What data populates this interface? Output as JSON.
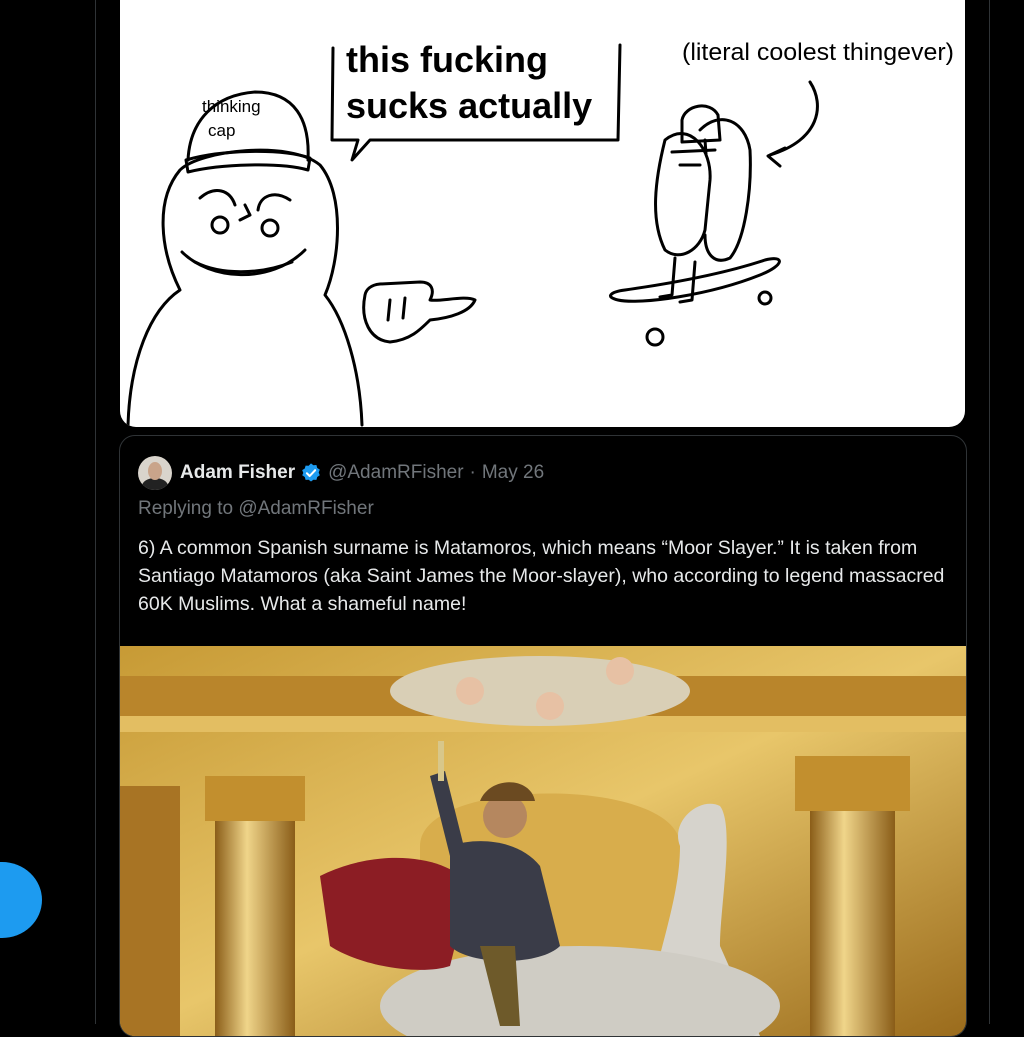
{
  "comic": {
    "cap_label_line1": "thinking",
    "cap_label_line2": "cap",
    "speech_line1": "this fucking",
    "speech_line2": "sucks actually",
    "annotation": "(literal coolest thingever)"
  },
  "quote_tweet": {
    "author_name": "Adam Fisher",
    "author_handle": "@AdamRFisher",
    "separator": "·",
    "date": "May 26",
    "replying_to": "Replying to @AdamRFisher",
    "text": "6) A common Spanish surname is Matamoros, which means “Moor Slayer.” It is taken from Santiago Matamoros (aka Saint James the Moor-slayer), who according to legend massacred 60K Muslims. What a shameful name!"
  },
  "colors": {
    "background": "#000000",
    "accent": "#1d9bf0",
    "border": "#2f3336",
    "muted_text": "#71767b",
    "primary_text": "#e7e9ea"
  },
  "icons": [
    "verified-badge-icon",
    "compose-fab"
  ]
}
